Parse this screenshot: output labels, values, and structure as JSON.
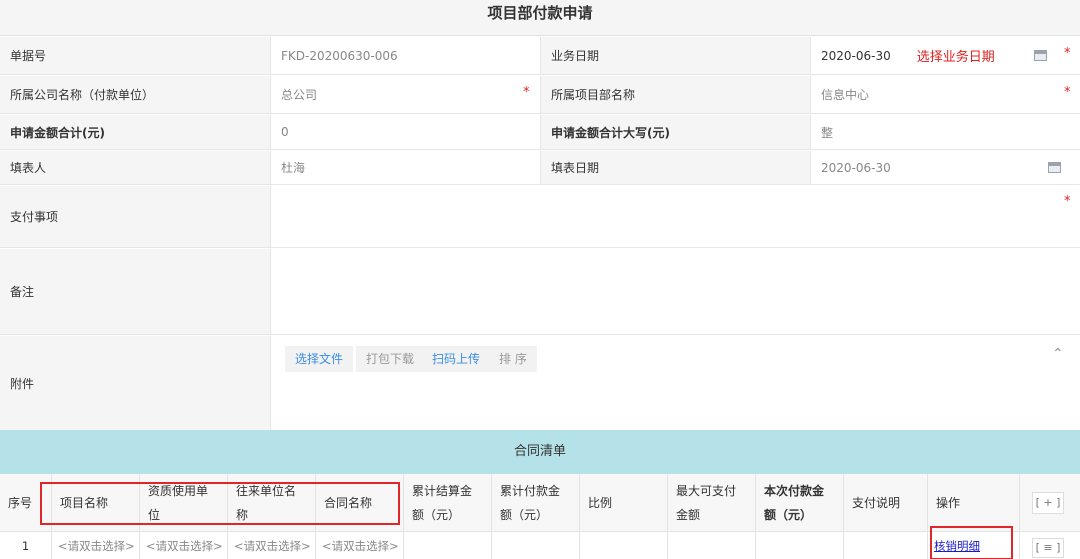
{
  "form": {
    "title": "项目部付款申请",
    "doc_no_label": "单据号",
    "doc_no_value": "FKD-20200630-006",
    "biz_date_label": "业务日期",
    "biz_date_value": "2020-06-30",
    "biz_date_hint": "选择业务日期",
    "company_label": "所属公司名称（付款单位）",
    "company_value": "总公司",
    "dept_label": "所属项目部名称",
    "dept_value": "信息中心",
    "amount_label": "申请金额合计(元)",
    "amount_value": "0",
    "amount_upper_label": "申请金额合计大写(元)",
    "amount_upper_value": "整",
    "filler_label": "填表人",
    "filler_value": "杜海",
    "fill_date_label": "填表日期",
    "fill_date_value": "2020-06-30",
    "pay_item_label": "支付事项",
    "remark_label": "备注",
    "attach_label": "附件",
    "required_mark": "*"
  },
  "attachments": {
    "select_file": "选择文件",
    "pack_download": "打包下载",
    "scan_upload": "扫码上传",
    "sort": "排 序",
    "collapse_icon": "chevron-up-icon"
  },
  "contract_list": {
    "title": "合同清单",
    "columns": [
      "序号",
      "项目名称",
      "资质使用单位",
      "往来单位名称",
      "合同名称",
      "累计结算金额（元）",
      "累计付款金额（元）",
      "比例",
      "最大可支付金额",
      "本次付款金额（元）",
      "支付说明",
      "操作"
    ],
    "add_button": "[ + ]",
    "row": {
      "index": "1",
      "project": "<请双击选择>",
      "qualification": "<请双击选择>",
      "partner": "<请双击选择>",
      "contract": "<请双击选择>",
      "operation": "核销明细",
      "list_button": "[ ≡ ]"
    }
  },
  "colors": {
    "required": "#e02020",
    "header_band": "#b4e2e8",
    "link": "#3a8ee6",
    "highlight_box": "#e0262a"
  }
}
